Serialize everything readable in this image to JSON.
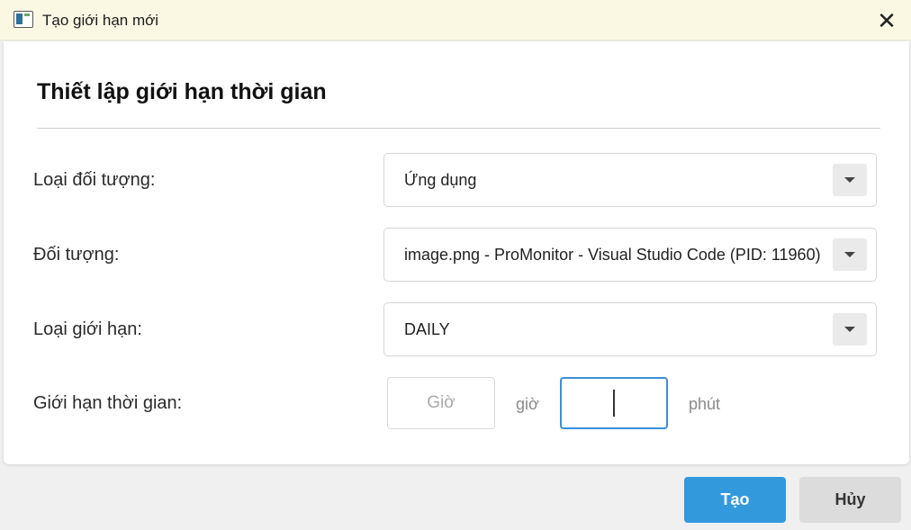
{
  "window": {
    "title": "Tạo giới hạn mới",
    "close_glyph": "✕"
  },
  "form": {
    "heading": "Thiết lập giới hạn thời gian",
    "object_type": {
      "label": "Loại đối tượng:",
      "value": "Ứng dụng"
    },
    "object": {
      "label": "Đối tượng:",
      "value": "image.png - ProMonitor - Visual Studio Code (PID: 11960)"
    },
    "limit_type": {
      "label": "Loại giới hạn:",
      "value": "DAILY"
    },
    "time_limit": {
      "label": "Giới hạn thời gian:",
      "hours_placeholder": "Giờ",
      "hours_value": "",
      "hours_unit": "giờ",
      "minutes_placeholder": "",
      "minutes_value": "",
      "minutes_unit": "phút"
    }
  },
  "buttons": {
    "create": "Tạo",
    "cancel": "Hủy"
  },
  "colors": {
    "titlebar_bg": "#faf8e3",
    "primary": "#3399dd",
    "secondary": "#dcdcdc",
    "focus_border": "#3b8ed8"
  }
}
